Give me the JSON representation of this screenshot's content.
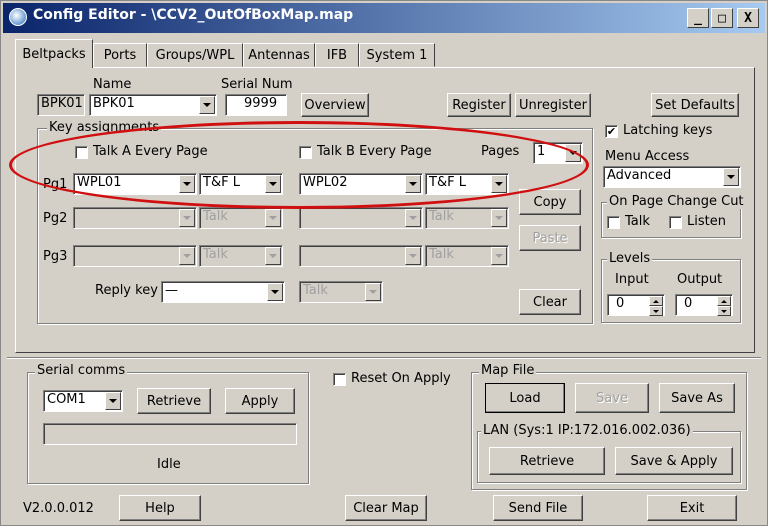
{
  "window": {
    "title": "Config Editor - \\CCV2_OutOfBoxMap.map",
    "minimize": "_",
    "maximize": "□",
    "close": "X"
  },
  "tabs": [
    "Beltpacks",
    "Ports",
    "Groups/WPL",
    "Antennas",
    "IFB",
    "System 1"
  ],
  "beltpack": {
    "name_label": "Name",
    "serial_label": "Serial Num",
    "id": "BPK01",
    "name": "BPK01",
    "serial": "9999",
    "overview": "Overview",
    "register": "Register",
    "unregister": "Unregister",
    "set_defaults": "Set Defaults"
  },
  "key_assignments": {
    "title": "Key assignments",
    "talk_a": "Talk A Every Page",
    "talk_b": "Talk B Every Page",
    "pages_label": "Pages",
    "pages_value": "1",
    "rows": [
      {
        "label": "Pg1",
        "a_group": "WPL01",
        "a_mode": "T&F L",
        "b_group": "WPL02",
        "b_mode": "T&F L"
      },
      {
        "label": "Pg2",
        "a_group": "",
        "a_mode": "Talk",
        "b_group": "",
        "b_mode": "Talk"
      },
      {
        "label": "Pg3",
        "a_group": "",
        "a_mode": "Talk",
        "b_group": "",
        "b_mode": "Talk"
      }
    ],
    "reply_label": "Reply key",
    "reply_value": "—",
    "reply_mode": "Talk",
    "copy": "Copy",
    "paste": "Paste",
    "clear": "Clear"
  },
  "side": {
    "latching": "Latching keys",
    "latching_checked": true,
    "menu_access_label": "Menu Access",
    "menu_access_value": "Advanced",
    "page_change_title": "On Page Change Cut",
    "talk": "Talk",
    "listen": "Listen",
    "levels_title": "Levels",
    "input_label": "Input",
    "output_label": "Output",
    "input_value": "0",
    "output_value": "0"
  },
  "serial_comms": {
    "title": "Serial comms",
    "port": "COM1",
    "retrieve": "Retrieve",
    "apply": "Apply",
    "status_text": "",
    "status": "Idle"
  },
  "reset_on_apply": "Reset On Apply",
  "map_file": {
    "title": "Map File",
    "load": "Load",
    "save": "Save",
    "save_as": "Save As",
    "lan_title": "LAN  (Sys:1 IP:172.016.002.036)",
    "retrieve": "Retrieve",
    "save_apply": "Save & Apply"
  },
  "footer": {
    "version": "V2.0.0.012",
    "help": "Help",
    "clear_map": "Clear Map",
    "send_file": "Send File",
    "exit": "Exit"
  },
  "colors": {
    "title_start": "#0a246a",
    "title_end": "#a6caf0",
    "face": "#d4d0c8",
    "annotation": "#d01010"
  },
  "icons": {
    "app": "config-editor-icon",
    "dropdown": "chevron-down-icon"
  }
}
